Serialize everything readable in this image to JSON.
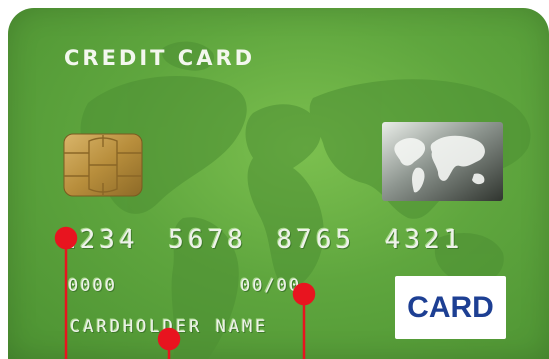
{
  "card": {
    "title": "CREDIT CARD",
    "number": "1234 5678 8765 4321",
    "valid_from": "0000",
    "expiry": "00/00",
    "holder_name": "CARDHOLDER NAME",
    "brand_label": "CARD"
  },
  "icons": {
    "chip": "chip-icon",
    "hologram": "hologram-globe-icon"
  },
  "colors": {
    "card_green": "#5fa63e",
    "text_emboss": "#eef2ea",
    "brand_blue": "#1d3f93",
    "pointer_red": "#e8141f"
  }
}
